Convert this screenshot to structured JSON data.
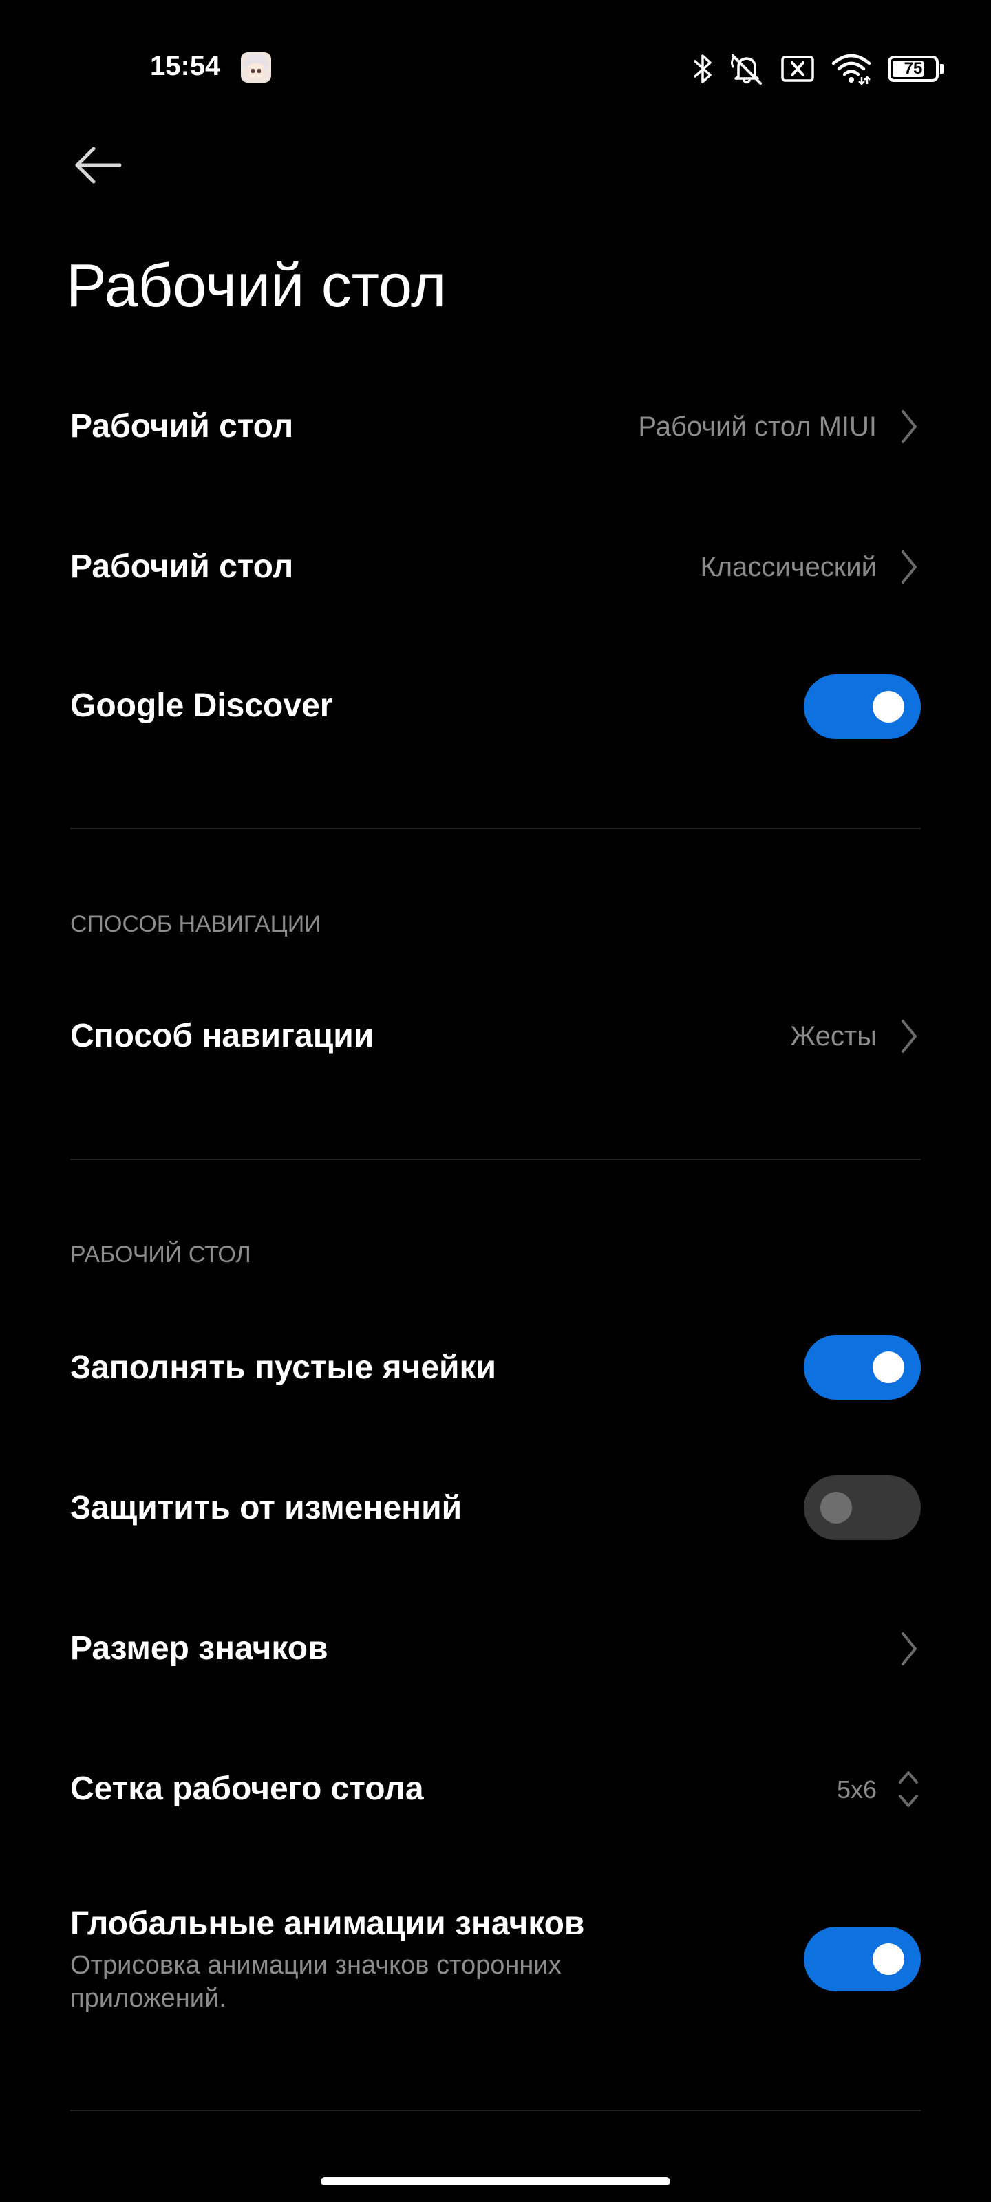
{
  "status_bar": {
    "time": "15:54",
    "battery_level": "75",
    "icons": [
      "bluetooth-icon",
      "mute-icon",
      "sim-x-icon",
      "wifi-icon",
      "battery-icon"
    ]
  },
  "header": {
    "title": "Рабочий стол",
    "back_icon": "arrow-left-icon"
  },
  "settings": {
    "desktop_type": {
      "label": "Рабочий стол",
      "value": "Рабочий стол MIUI"
    },
    "desktop_mode": {
      "label": "Рабочий стол",
      "value": "Классический"
    },
    "google_discover": {
      "label": "Google Discover",
      "enabled": true
    }
  },
  "navigation_section": {
    "header": "СПОСОБ НАВИГАЦИИ",
    "nav_method": {
      "label": "Способ навигации",
      "value": "Жесты"
    }
  },
  "desktop_section": {
    "header": "РАБОЧИЙ СТОЛ",
    "fill_empty_cells": {
      "label": "Заполнять пустые ячейки",
      "enabled": true
    },
    "lock_layout": {
      "label": "Защитить от изменений",
      "enabled": false
    },
    "icon_size": {
      "label": "Размер значков"
    },
    "grid": {
      "label": "Сетка рабочего стола",
      "value": "5x6"
    },
    "global_animations": {
      "label": "Глобальные анимации значков",
      "description": "Отрисовка анимации значков сторонних приложений.",
      "enabled": true
    }
  },
  "colors": {
    "background": "#000000",
    "accent": "#0d72e0",
    "secondary_text": "#8c8c8c",
    "toggle_off": "#383838"
  }
}
